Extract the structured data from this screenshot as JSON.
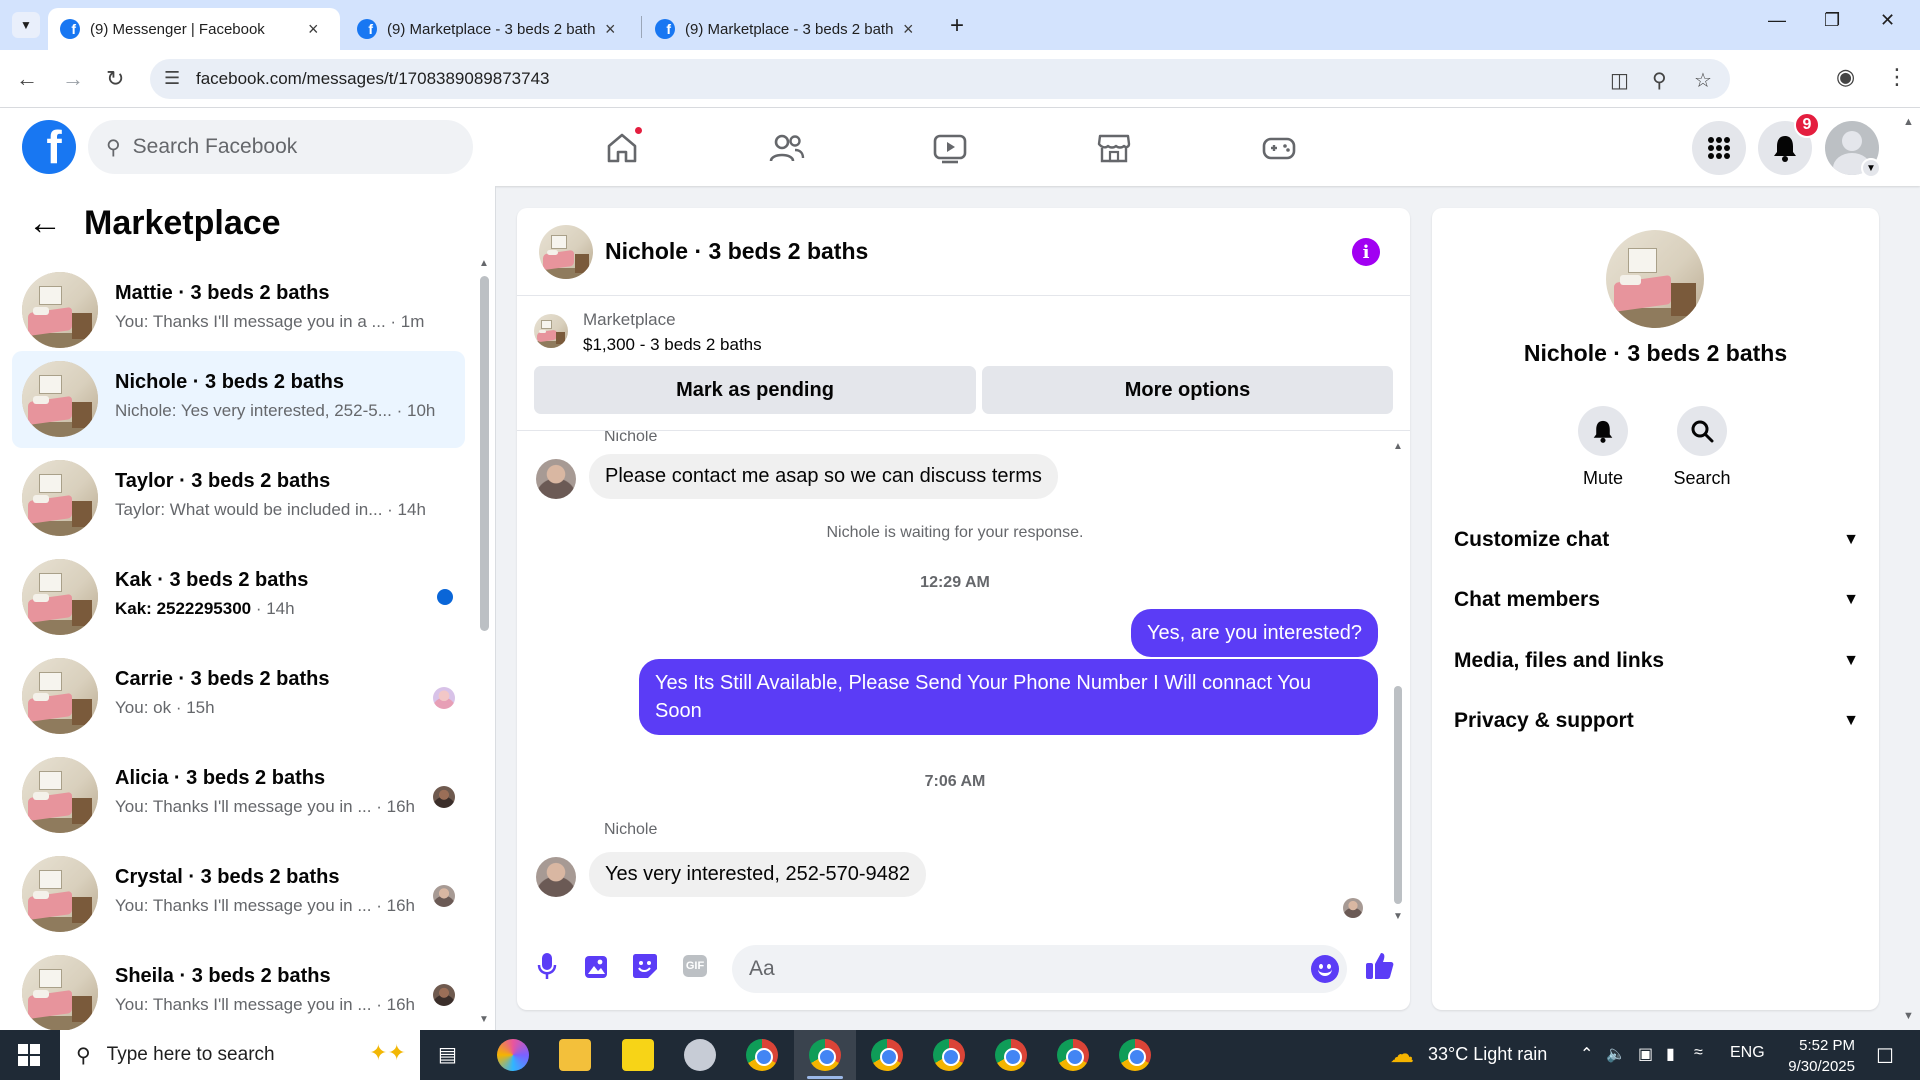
{
  "browser": {
    "tabs": [
      {
        "title": "(9) Messenger | Facebook",
        "active": true
      },
      {
        "title": "(9) Marketplace - 3 beds 2 bath",
        "active": false
      },
      {
        "title": "(9) Marketplace - 3 beds 2 bath",
        "active": false
      }
    ],
    "new_tab": "+",
    "url": "facebook.com/messages/t/1708389089873743"
  },
  "fb_header": {
    "logo": "f",
    "search_placeholder": "Search Facebook",
    "notifications_count": "9",
    "nav_icons": [
      "home-icon",
      "friends-icon",
      "watch-icon",
      "marketplace-icon",
      "gaming-icon"
    ]
  },
  "sidebar": {
    "title": "Marketplace",
    "conversations": [
      {
        "name": "Mattie · 3 beds 2 baths",
        "preview": "You: Thanks I'll message you in a ...",
        "time": "· 1m",
        "unread": false
      },
      {
        "name": "Nichole · 3 beds 2 baths",
        "preview": "Nichole: Yes very interested, 252-5...",
        "time": "· 10h",
        "unread": false,
        "selected": true
      },
      {
        "name": "Taylor · 3 beds 2 baths",
        "preview": "Taylor: What would be included in...",
        "time": "· 14h",
        "unread": false
      },
      {
        "name": "Kak · 3 beds 2 baths",
        "preview": "Kak: 2522295300",
        "time": " · 14h",
        "unread": true
      },
      {
        "name": "Carrie · 3 beds 2 baths",
        "preview": "You: ok",
        "time": " · 15h",
        "unread": false
      },
      {
        "name": "Alicia · 3 beds 2 baths",
        "preview": "You: Thanks I'll message you in ...",
        "time": " · 16h",
        "unread": false
      },
      {
        "name": "Crystal · 3 beds 2 baths",
        "preview": "You: Thanks I'll message you in ...",
        "time": " · 16h",
        "unread": false
      },
      {
        "name": "Sheila · 3 beds 2 baths",
        "preview": "You: Thanks I'll message you in ...",
        "time": " · 16h",
        "unread": false
      }
    ]
  },
  "chat": {
    "title": "Nichole · 3 beds 2 baths",
    "listing": {
      "source": "Marketplace",
      "price_title": "$1,300 - 3 beds 2 baths",
      "mark_pending": "Mark as pending",
      "more_options": "More options"
    },
    "messages": {
      "sender1": "Nichole",
      "msg1": "Please contact me asap so we can discuss terms",
      "waiting": "Nichole is waiting for your response.",
      "ts1": "12:29 AM",
      "out1": "Yes, are you interested?",
      "out2": "Yes Its Still Available, Please Send Your Phone Number I Will connact You Soon",
      "ts2": "7:06 AM",
      "sender2": "Nichole",
      "msg2": "Yes very interested, 252-570-9482"
    },
    "composer_placeholder": "Aa",
    "gif_label": "GIF"
  },
  "info_panel": {
    "name": "Nichole · 3 beds 2 baths",
    "actions": [
      {
        "label": "Mute",
        "icon": "bell-icon"
      },
      {
        "label": "Search",
        "icon": "search-icon"
      }
    ],
    "sections": [
      "Customize chat",
      "Chat members",
      "Media, files and links",
      "Privacy & support"
    ]
  },
  "taskbar": {
    "search_placeholder": "Type here to search",
    "weather": "33°C  Light rain",
    "language": "ENG",
    "time": "5:52 PM",
    "date": "9/30/2025"
  },
  "colors": {
    "fb_blue": "#1877f2",
    "outgoing_bubble": "#5b3cf6",
    "selected_row": "#ebf5ff",
    "info_purple": "#a100f2"
  }
}
